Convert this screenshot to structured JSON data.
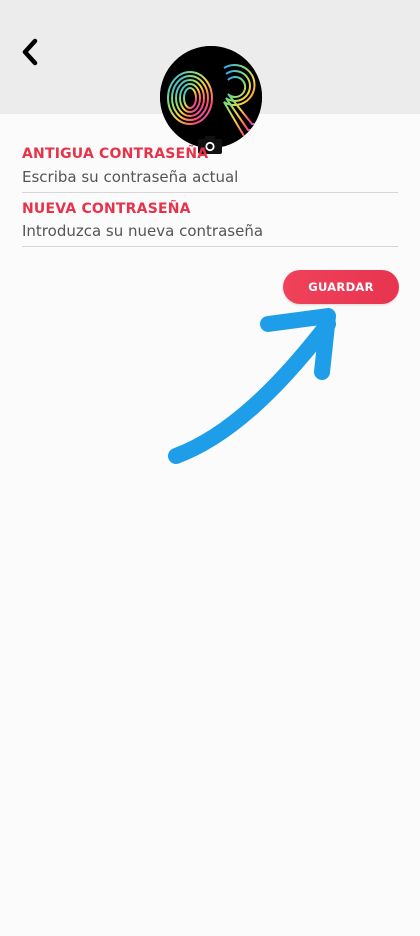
{
  "header": {
    "back_icon": "chevron-left-icon",
    "avatar_icon": "profile-avatar",
    "camera_icon": "camera-icon"
  },
  "form": {
    "old_password": {
      "label": "ANTIGUA CONTRASEÑA",
      "placeholder": "Escriba su contraseña actual",
      "value": ""
    },
    "new_password": {
      "label": "NUEVA CONTRASEÑA",
      "placeholder": "Introduzca su nueva contraseña",
      "value": ""
    },
    "save_label": "GUARDAR"
  },
  "annotation": {
    "arrow_icon": "arrow-up-right-icon",
    "color": "#1e9ee8"
  },
  "colors": {
    "accent": "#e8324a",
    "header_bg": "#ececec",
    "page_bg": "#fbfbfb"
  }
}
